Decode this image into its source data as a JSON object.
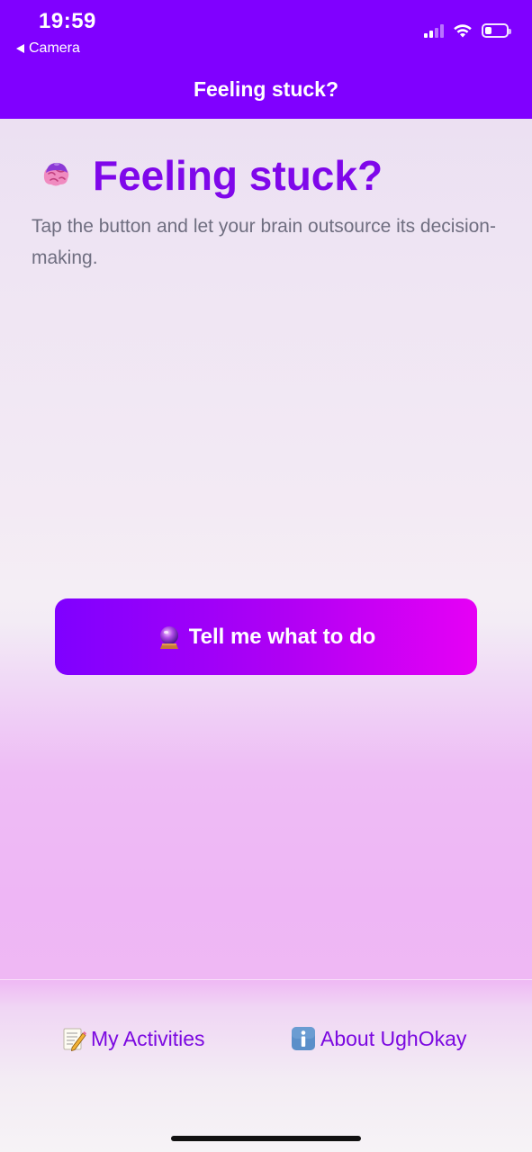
{
  "status_bar": {
    "time": "19:59",
    "back_label": "Camera"
  },
  "nav": {
    "title": "Feeling stuck?"
  },
  "main": {
    "heading": "Feeling stuck?",
    "heading_icon": "brain-icon",
    "subtitle": "Tap the button and let your brain outsource its decision-making.",
    "cta_label": "Tell me what to do",
    "cta_icon": "crystal-ball-icon"
  },
  "footer": {
    "activities_label": "My Activities",
    "activities_icon": "memo-icon",
    "about_label": "About UghOkay",
    "about_icon": "info-icon"
  },
  "colors": {
    "brand_purple": "#8000ff",
    "heading_purple": "#7f07ea",
    "cta_gradient_start": "#7f00ff",
    "cta_gradient_end": "#e600f5",
    "subtitle_gray": "#6f6e80"
  }
}
